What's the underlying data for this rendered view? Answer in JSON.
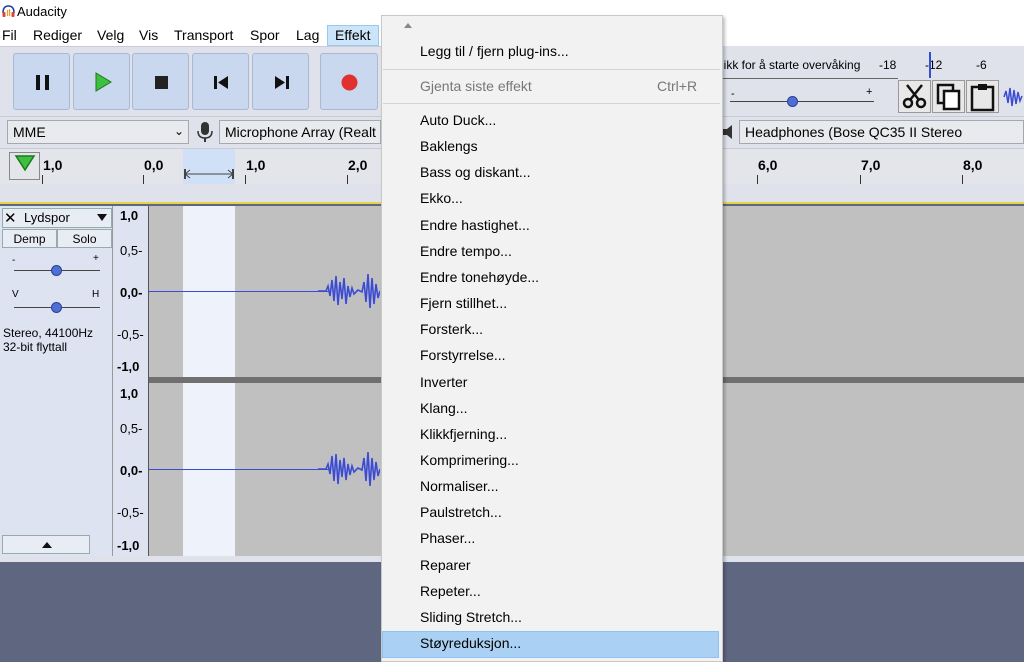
{
  "window": {
    "title": "Audacity"
  },
  "menubar": {
    "items": [
      "Fil",
      "Rediger",
      "Velg",
      "Vis",
      "Transport",
      "Spor",
      "Lag",
      "Effekt"
    ]
  },
  "meter": {
    "hint": "likk for å starte overvåking",
    "ticks": [
      "-18",
      "-12",
      "-6"
    ]
  },
  "devices": {
    "host": "MME",
    "mic": "Microphone Array (Realt",
    "output": "Headphones (Bose QC35 II Stereo"
  },
  "ruler": {
    "labels": [
      "1,0",
      "0,0",
      "1,0",
      "2,0",
      "6,0",
      "7,0",
      "8,0"
    ]
  },
  "track": {
    "name": "Lydspor",
    "mute": "Demp",
    "solo": "Solo",
    "gain_minus": "-",
    "gain_plus": "+",
    "pan_left": "V",
    "pan_right": "H",
    "info_line1": "Stereo, 44100Hz",
    "info_line2": "32-bit flyttall",
    "scale1": [
      "1,0",
      "0,5-",
      "0,0-",
      "-0,5-",
      "-1,0"
    ],
    "scale2": [
      "1,0",
      "0,5-",
      "0,0-",
      "-0,5-",
      "-1,0"
    ]
  },
  "effekt_menu": {
    "plugins": "Legg til / fjern plug-ins...",
    "repeat_last": "Gjenta siste effekt",
    "repeat_shortcut": "Ctrl+R",
    "items": [
      "Auto Duck...",
      "Baklengs",
      "Bass og diskant...",
      "Ekko...",
      "Endre hastighet...",
      "Endre tempo...",
      "Endre tonehøyde...",
      "Fjern stillhet...",
      "Forsterk...",
      "Forstyrrelse...",
      "Inverter",
      "Klang...",
      "Klikkfjerning...",
      "Komprimering...",
      "Normaliser...",
      "Paulstretch...",
      "Phaser...",
      "Reparer",
      "Repeter...",
      "Sliding Stretch...",
      "Støyreduksjon..."
    ],
    "highlighted": "Støyreduksjon..."
  },
  "colors": {
    "accent": "#aad1f3",
    "waveform": "#3b4bd3",
    "record": "#e03030"
  }
}
